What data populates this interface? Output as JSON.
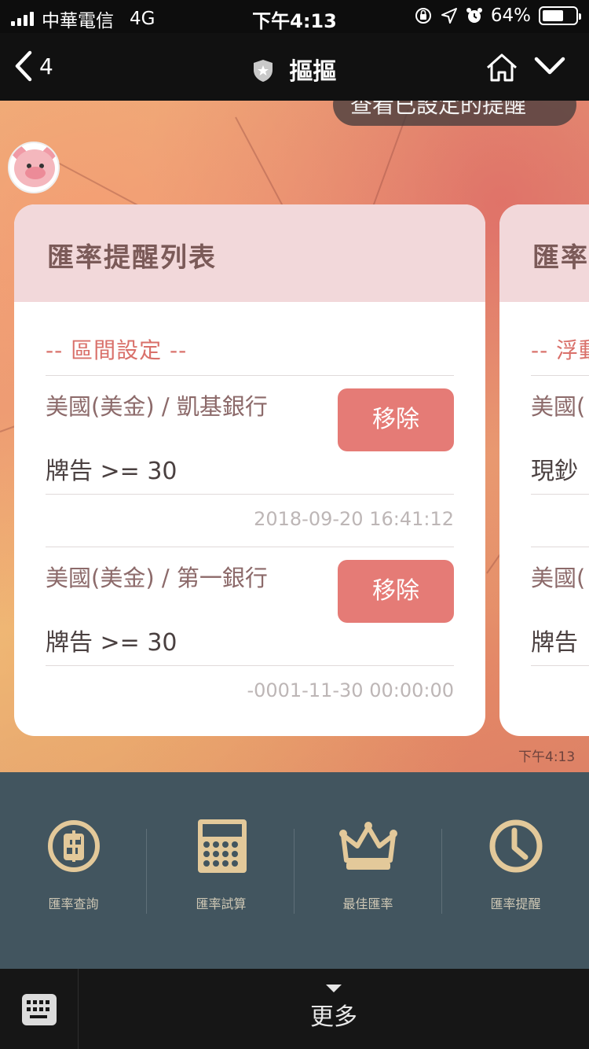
{
  "status_bar": {
    "carrier": "中華電信",
    "network": "4G",
    "time": "下午4:13",
    "battery_percent": "64%",
    "battery_level": 0.64
  },
  "nav": {
    "back_count": "4",
    "title": "摳摳"
  },
  "toast": {
    "text": "查看已設定的提醒"
  },
  "cards": [
    {
      "title": "匯率提醒列表",
      "section": "-- 區間設定 --",
      "items": [
        {
          "bank": "美國(美金) / 凱基銀行",
          "condition": "牌告 >= 30",
          "remove": "移除",
          "timestamp": "2018-09-20 16:41:12"
        },
        {
          "bank": "美國(美金) / 第一銀行",
          "condition": "牌告 >= 30",
          "remove": "移除",
          "timestamp": "-0001-11-30 00:00:00"
        }
      ]
    },
    {
      "title": "匯率",
      "section": "-- 浮動",
      "items": [
        {
          "bank": "美國(",
          "condition": "現鈔"
        },
        {
          "bank": "美國(",
          "condition": "牌告"
        }
      ]
    }
  ],
  "message_time": "下午4:13",
  "menu": {
    "items": [
      {
        "label": "匯率查詢",
        "icon": "dollar-coin-icon"
      },
      {
        "label": "匯率試算",
        "icon": "calculator-icon"
      },
      {
        "label": "最佳匯率",
        "icon": "crown-icon"
      },
      {
        "label": "匯率提醒",
        "icon": "clock-icon"
      }
    ],
    "icon_color": "#e3c99a"
  },
  "bottom_bar": {
    "more_label": "更多"
  }
}
